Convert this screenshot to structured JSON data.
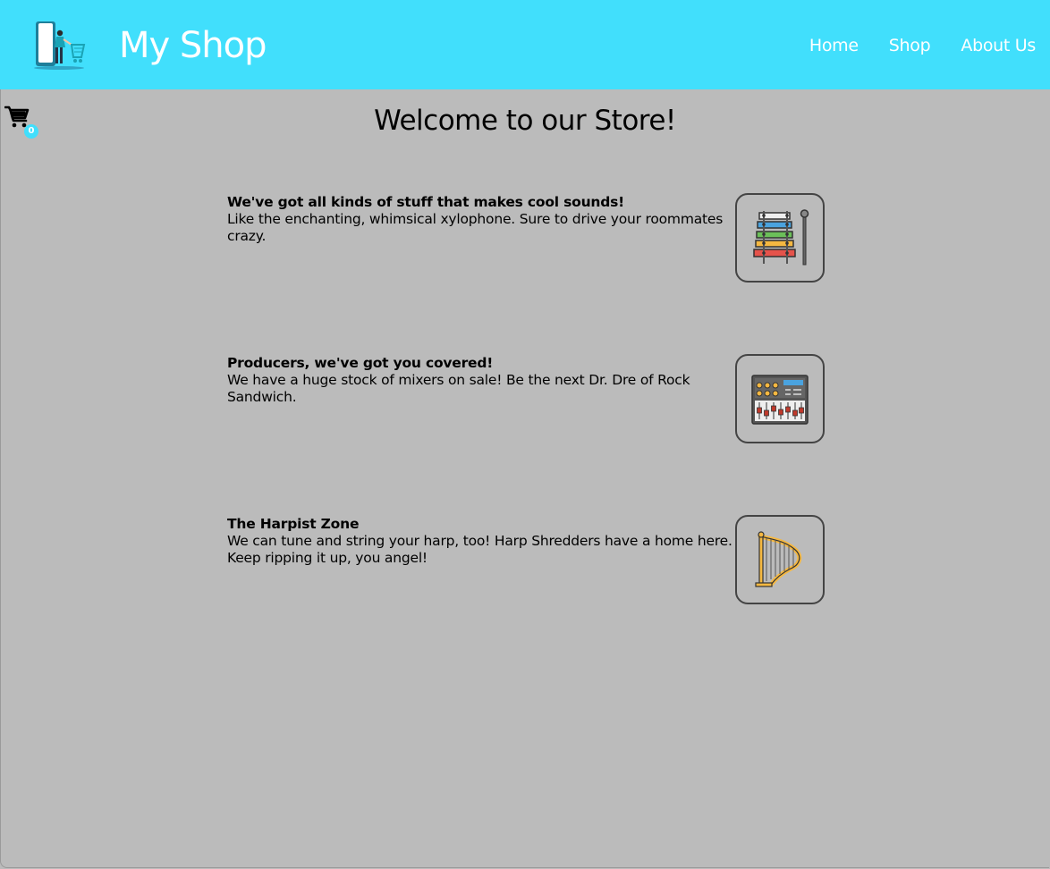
{
  "header": {
    "brand": "My Shop",
    "logo_icon": "shopper-cart-icon",
    "nav": [
      {
        "label": "Home"
      },
      {
        "label": "Shop"
      },
      {
        "label": "About Us"
      }
    ],
    "background_color": "#41dffc"
  },
  "cart": {
    "icon": "shopping-cart-icon",
    "count": "0"
  },
  "main": {
    "title": "Welcome to our Store!",
    "background_color": "#bbbbbb",
    "features": [
      {
        "heading": "We've got all kinds of stuff that makes cool sounds!",
        "body": "Like the enchanting, whimsical xylophone. Sure to drive your roommates crazy.",
        "icon": "xylophone-icon"
      },
      {
        "heading": "Producers, we've got you covered!",
        "body": "We have a huge stock of mixers on sale! Be the next Dr. Dre of Rock Sandwich.",
        "icon": "mixer-icon"
      },
      {
        "heading": "The Harpist Zone",
        "body": "We can tune and string your harp, too! Harp Shredders have a home here. Keep ripping it up, you angel!",
        "icon": "harp-icon"
      }
    ]
  }
}
